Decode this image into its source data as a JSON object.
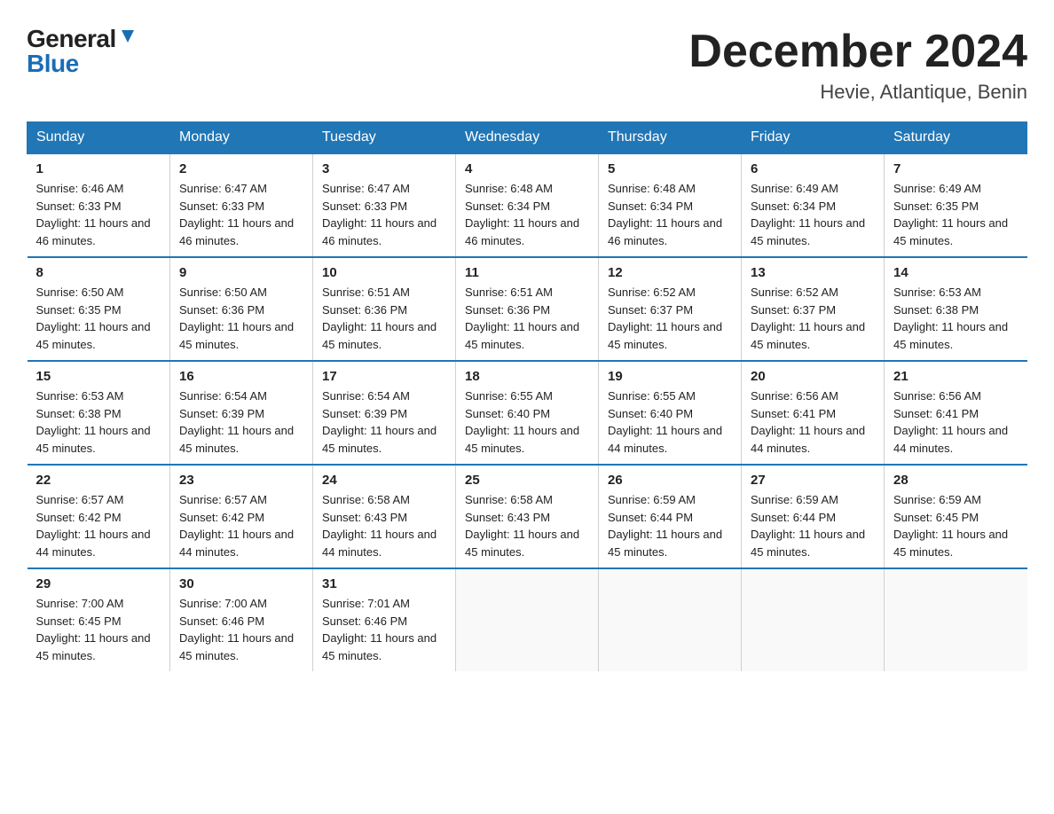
{
  "logo": {
    "general": "General",
    "blue": "Blue"
  },
  "title": "December 2024",
  "location": "Hevie, Atlantique, Benin",
  "days_of_week": [
    "Sunday",
    "Monday",
    "Tuesday",
    "Wednesday",
    "Thursday",
    "Friday",
    "Saturday"
  ],
  "weeks": [
    [
      {
        "day": "1",
        "sunrise": "6:46 AM",
        "sunset": "6:33 PM",
        "daylight": "11 hours and 46 minutes."
      },
      {
        "day": "2",
        "sunrise": "6:47 AM",
        "sunset": "6:33 PM",
        "daylight": "11 hours and 46 minutes."
      },
      {
        "day": "3",
        "sunrise": "6:47 AM",
        "sunset": "6:33 PM",
        "daylight": "11 hours and 46 minutes."
      },
      {
        "day": "4",
        "sunrise": "6:48 AM",
        "sunset": "6:34 PM",
        "daylight": "11 hours and 46 minutes."
      },
      {
        "day": "5",
        "sunrise": "6:48 AM",
        "sunset": "6:34 PM",
        "daylight": "11 hours and 46 minutes."
      },
      {
        "day": "6",
        "sunrise": "6:49 AM",
        "sunset": "6:34 PM",
        "daylight": "11 hours and 45 minutes."
      },
      {
        "day": "7",
        "sunrise": "6:49 AM",
        "sunset": "6:35 PM",
        "daylight": "11 hours and 45 minutes."
      }
    ],
    [
      {
        "day": "8",
        "sunrise": "6:50 AM",
        "sunset": "6:35 PM",
        "daylight": "11 hours and 45 minutes."
      },
      {
        "day": "9",
        "sunrise": "6:50 AM",
        "sunset": "6:36 PM",
        "daylight": "11 hours and 45 minutes."
      },
      {
        "day": "10",
        "sunrise": "6:51 AM",
        "sunset": "6:36 PM",
        "daylight": "11 hours and 45 minutes."
      },
      {
        "day": "11",
        "sunrise": "6:51 AM",
        "sunset": "6:36 PM",
        "daylight": "11 hours and 45 minutes."
      },
      {
        "day": "12",
        "sunrise": "6:52 AM",
        "sunset": "6:37 PM",
        "daylight": "11 hours and 45 minutes."
      },
      {
        "day": "13",
        "sunrise": "6:52 AM",
        "sunset": "6:37 PM",
        "daylight": "11 hours and 45 minutes."
      },
      {
        "day": "14",
        "sunrise": "6:53 AM",
        "sunset": "6:38 PM",
        "daylight": "11 hours and 45 minutes."
      }
    ],
    [
      {
        "day": "15",
        "sunrise": "6:53 AM",
        "sunset": "6:38 PM",
        "daylight": "11 hours and 45 minutes."
      },
      {
        "day": "16",
        "sunrise": "6:54 AM",
        "sunset": "6:39 PM",
        "daylight": "11 hours and 45 minutes."
      },
      {
        "day": "17",
        "sunrise": "6:54 AM",
        "sunset": "6:39 PM",
        "daylight": "11 hours and 45 minutes."
      },
      {
        "day": "18",
        "sunrise": "6:55 AM",
        "sunset": "6:40 PM",
        "daylight": "11 hours and 45 minutes."
      },
      {
        "day": "19",
        "sunrise": "6:55 AM",
        "sunset": "6:40 PM",
        "daylight": "11 hours and 44 minutes."
      },
      {
        "day": "20",
        "sunrise": "6:56 AM",
        "sunset": "6:41 PM",
        "daylight": "11 hours and 44 minutes."
      },
      {
        "day": "21",
        "sunrise": "6:56 AM",
        "sunset": "6:41 PM",
        "daylight": "11 hours and 44 minutes."
      }
    ],
    [
      {
        "day": "22",
        "sunrise": "6:57 AM",
        "sunset": "6:42 PM",
        "daylight": "11 hours and 44 minutes."
      },
      {
        "day": "23",
        "sunrise": "6:57 AM",
        "sunset": "6:42 PM",
        "daylight": "11 hours and 44 minutes."
      },
      {
        "day": "24",
        "sunrise": "6:58 AM",
        "sunset": "6:43 PM",
        "daylight": "11 hours and 44 minutes."
      },
      {
        "day": "25",
        "sunrise": "6:58 AM",
        "sunset": "6:43 PM",
        "daylight": "11 hours and 45 minutes."
      },
      {
        "day": "26",
        "sunrise": "6:59 AM",
        "sunset": "6:44 PM",
        "daylight": "11 hours and 45 minutes."
      },
      {
        "day": "27",
        "sunrise": "6:59 AM",
        "sunset": "6:44 PM",
        "daylight": "11 hours and 45 minutes."
      },
      {
        "day": "28",
        "sunrise": "6:59 AM",
        "sunset": "6:45 PM",
        "daylight": "11 hours and 45 minutes."
      }
    ],
    [
      {
        "day": "29",
        "sunrise": "7:00 AM",
        "sunset": "6:45 PM",
        "daylight": "11 hours and 45 minutes."
      },
      {
        "day": "30",
        "sunrise": "7:00 AM",
        "sunset": "6:46 PM",
        "daylight": "11 hours and 45 minutes."
      },
      {
        "day": "31",
        "sunrise": "7:01 AM",
        "sunset": "6:46 PM",
        "daylight": "11 hours and 45 minutes."
      },
      null,
      null,
      null,
      null
    ]
  ]
}
